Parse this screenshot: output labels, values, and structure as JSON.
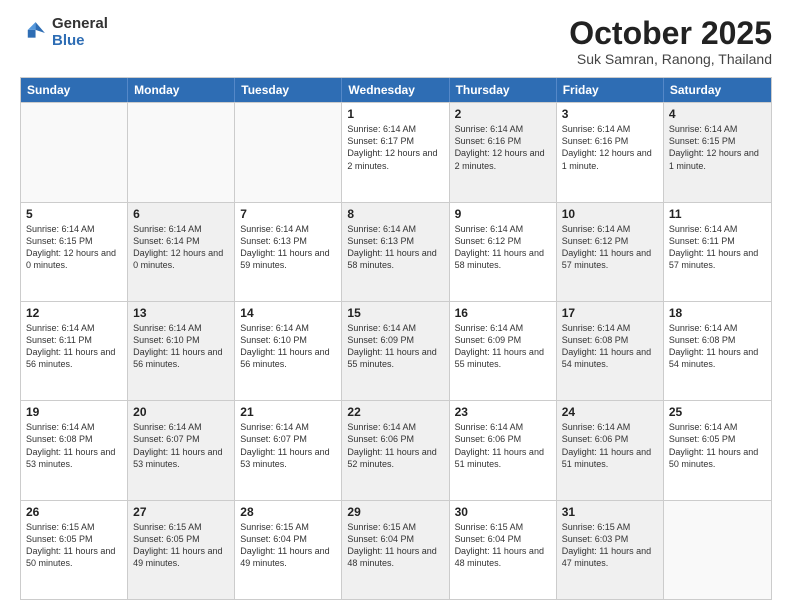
{
  "logo": {
    "general": "General",
    "blue": "Blue"
  },
  "title": {
    "month": "October 2025",
    "location": "Suk Samran, Ranong, Thailand"
  },
  "days": [
    "Sunday",
    "Monday",
    "Tuesday",
    "Wednesday",
    "Thursday",
    "Friday",
    "Saturday"
  ],
  "weeks": [
    [
      {
        "day": "",
        "info": "",
        "shaded": false,
        "empty": true
      },
      {
        "day": "",
        "info": "",
        "shaded": false,
        "empty": true
      },
      {
        "day": "",
        "info": "",
        "shaded": false,
        "empty": true
      },
      {
        "day": "1",
        "info": "Sunrise: 6:14 AM\nSunset: 6:17 PM\nDaylight: 12 hours\nand 2 minutes.",
        "shaded": false,
        "empty": false
      },
      {
        "day": "2",
        "info": "Sunrise: 6:14 AM\nSunset: 6:16 PM\nDaylight: 12 hours\nand 2 minutes.",
        "shaded": true,
        "empty": false
      },
      {
        "day": "3",
        "info": "Sunrise: 6:14 AM\nSunset: 6:16 PM\nDaylight: 12 hours\nand 1 minute.",
        "shaded": false,
        "empty": false
      },
      {
        "day": "4",
        "info": "Sunrise: 6:14 AM\nSunset: 6:15 PM\nDaylight: 12 hours\nand 1 minute.",
        "shaded": true,
        "empty": false
      }
    ],
    [
      {
        "day": "5",
        "info": "Sunrise: 6:14 AM\nSunset: 6:15 PM\nDaylight: 12 hours\nand 0 minutes.",
        "shaded": false,
        "empty": false
      },
      {
        "day": "6",
        "info": "Sunrise: 6:14 AM\nSunset: 6:14 PM\nDaylight: 12 hours\nand 0 minutes.",
        "shaded": true,
        "empty": false
      },
      {
        "day": "7",
        "info": "Sunrise: 6:14 AM\nSunset: 6:13 PM\nDaylight: 11 hours\nand 59 minutes.",
        "shaded": false,
        "empty": false
      },
      {
        "day": "8",
        "info": "Sunrise: 6:14 AM\nSunset: 6:13 PM\nDaylight: 11 hours\nand 58 minutes.",
        "shaded": true,
        "empty": false
      },
      {
        "day": "9",
        "info": "Sunrise: 6:14 AM\nSunset: 6:12 PM\nDaylight: 11 hours\nand 58 minutes.",
        "shaded": false,
        "empty": false
      },
      {
        "day": "10",
        "info": "Sunrise: 6:14 AM\nSunset: 6:12 PM\nDaylight: 11 hours\nand 57 minutes.",
        "shaded": true,
        "empty": false
      },
      {
        "day": "11",
        "info": "Sunrise: 6:14 AM\nSunset: 6:11 PM\nDaylight: 11 hours\nand 57 minutes.",
        "shaded": false,
        "empty": false
      }
    ],
    [
      {
        "day": "12",
        "info": "Sunrise: 6:14 AM\nSunset: 6:11 PM\nDaylight: 11 hours\nand 56 minutes.",
        "shaded": false,
        "empty": false
      },
      {
        "day": "13",
        "info": "Sunrise: 6:14 AM\nSunset: 6:10 PM\nDaylight: 11 hours\nand 56 minutes.",
        "shaded": true,
        "empty": false
      },
      {
        "day": "14",
        "info": "Sunrise: 6:14 AM\nSunset: 6:10 PM\nDaylight: 11 hours\nand 56 minutes.",
        "shaded": false,
        "empty": false
      },
      {
        "day": "15",
        "info": "Sunrise: 6:14 AM\nSunset: 6:09 PM\nDaylight: 11 hours\nand 55 minutes.",
        "shaded": true,
        "empty": false
      },
      {
        "day": "16",
        "info": "Sunrise: 6:14 AM\nSunset: 6:09 PM\nDaylight: 11 hours\nand 55 minutes.",
        "shaded": false,
        "empty": false
      },
      {
        "day": "17",
        "info": "Sunrise: 6:14 AM\nSunset: 6:08 PM\nDaylight: 11 hours\nand 54 minutes.",
        "shaded": true,
        "empty": false
      },
      {
        "day": "18",
        "info": "Sunrise: 6:14 AM\nSunset: 6:08 PM\nDaylight: 11 hours\nand 54 minutes.",
        "shaded": false,
        "empty": false
      }
    ],
    [
      {
        "day": "19",
        "info": "Sunrise: 6:14 AM\nSunset: 6:08 PM\nDaylight: 11 hours\nand 53 minutes.",
        "shaded": false,
        "empty": false
      },
      {
        "day": "20",
        "info": "Sunrise: 6:14 AM\nSunset: 6:07 PM\nDaylight: 11 hours\nand 53 minutes.",
        "shaded": true,
        "empty": false
      },
      {
        "day": "21",
        "info": "Sunrise: 6:14 AM\nSunset: 6:07 PM\nDaylight: 11 hours\nand 53 minutes.",
        "shaded": false,
        "empty": false
      },
      {
        "day": "22",
        "info": "Sunrise: 6:14 AM\nSunset: 6:06 PM\nDaylight: 11 hours\nand 52 minutes.",
        "shaded": true,
        "empty": false
      },
      {
        "day": "23",
        "info": "Sunrise: 6:14 AM\nSunset: 6:06 PM\nDaylight: 11 hours\nand 51 minutes.",
        "shaded": false,
        "empty": false
      },
      {
        "day": "24",
        "info": "Sunrise: 6:14 AM\nSunset: 6:06 PM\nDaylight: 11 hours\nand 51 minutes.",
        "shaded": true,
        "empty": false
      },
      {
        "day": "25",
        "info": "Sunrise: 6:14 AM\nSunset: 6:05 PM\nDaylight: 11 hours\nand 50 minutes.",
        "shaded": false,
        "empty": false
      }
    ],
    [
      {
        "day": "26",
        "info": "Sunrise: 6:15 AM\nSunset: 6:05 PM\nDaylight: 11 hours\nand 50 minutes.",
        "shaded": false,
        "empty": false
      },
      {
        "day": "27",
        "info": "Sunrise: 6:15 AM\nSunset: 6:05 PM\nDaylight: 11 hours\nand 49 minutes.",
        "shaded": true,
        "empty": false
      },
      {
        "day": "28",
        "info": "Sunrise: 6:15 AM\nSunset: 6:04 PM\nDaylight: 11 hours\nand 49 minutes.",
        "shaded": false,
        "empty": false
      },
      {
        "day": "29",
        "info": "Sunrise: 6:15 AM\nSunset: 6:04 PM\nDaylight: 11 hours\nand 48 minutes.",
        "shaded": true,
        "empty": false
      },
      {
        "day": "30",
        "info": "Sunrise: 6:15 AM\nSunset: 6:04 PM\nDaylight: 11 hours\nand 48 minutes.",
        "shaded": false,
        "empty": false
      },
      {
        "day": "31",
        "info": "Sunrise: 6:15 AM\nSunset: 6:03 PM\nDaylight: 11 hours\nand 47 minutes.",
        "shaded": true,
        "empty": false
      },
      {
        "day": "",
        "info": "",
        "shaded": false,
        "empty": true
      }
    ]
  ]
}
